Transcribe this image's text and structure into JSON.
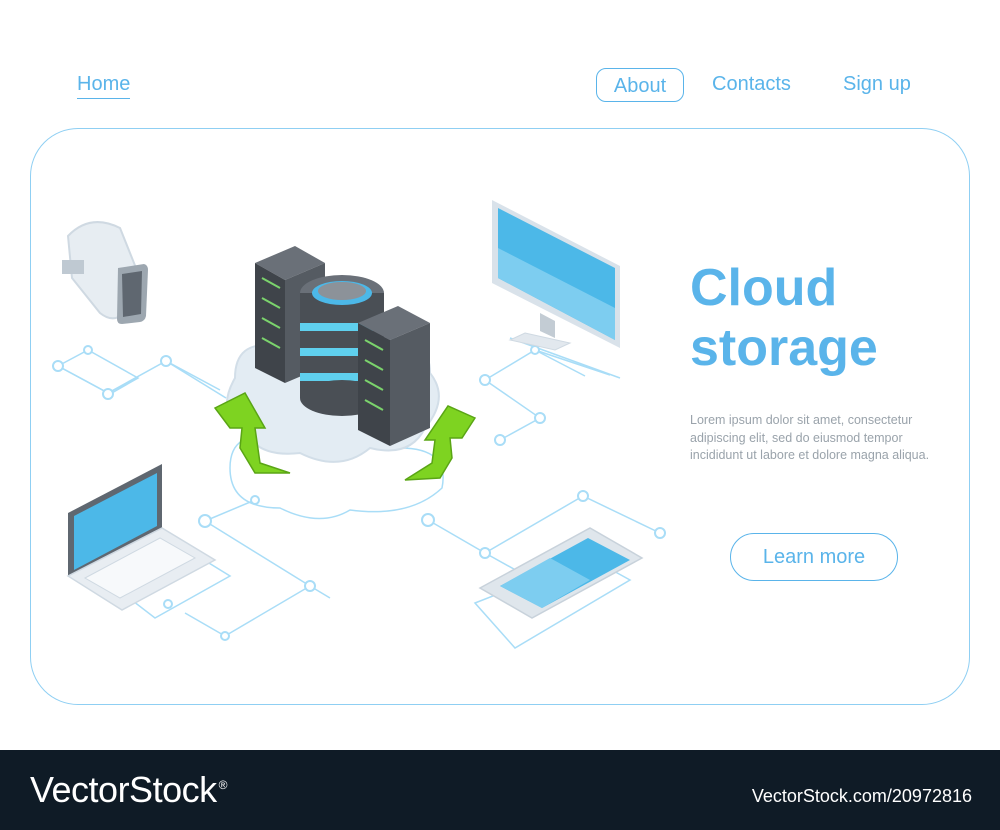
{
  "nav": {
    "home": "Home",
    "about": "About",
    "contacts": "Contacts",
    "signup": "Sign up"
  },
  "hero": {
    "title_line1": "Cloud",
    "title_line2": "storage",
    "body": "Lorem ipsum dolor sit amet, consectetur adipiscing elit, sed do eiusmod tempor incididunt ut labore et dolore magna aliqua.",
    "cta": "Learn more"
  },
  "footer": {
    "brand": "VectorStock",
    "registered": "®",
    "stock_id": "VectorStock.com/20972816"
  },
  "colors": {
    "accent": "#5ab4ea",
    "panel_border": "#8fcff3",
    "arrow_green": "#7ed321",
    "server_dark": "#4a4f55",
    "screen_blue": "#4cb8e8",
    "footer_bg": "#0f1b26"
  },
  "illustration": {
    "icons": [
      "smartwatch-icon",
      "server-rack-icon",
      "database-icon",
      "cloud-icon",
      "monitor-icon",
      "laptop-icon",
      "smartphone-icon",
      "upload-arrow-icon"
    ]
  }
}
